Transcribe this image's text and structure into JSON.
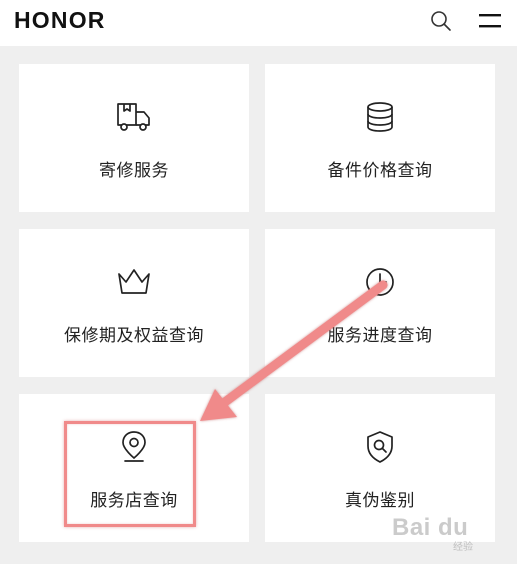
{
  "header": {
    "logo": "HONOR",
    "search_icon": "search-icon",
    "menu_icon": "hamburger-menu-icon"
  },
  "services": [
    {
      "label": "寄修服务",
      "icon": "delivery-truck-icon"
    },
    {
      "label": "备件价格查询",
      "icon": "database-stack-icon"
    },
    {
      "label": "保修期及权益查询",
      "icon": "crown-icon"
    },
    {
      "label": "服务进度查询",
      "icon": "clock-icon"
    },
    {
      "label": "服务店查询",
      "icon": "location-pin-icon"
    },
    {
      "label": "真伪鉴别",
      "icon": "shield-search-icon"
    }
  ],
  "annotation": {
    "highlight_color": "#f08a8a",
    "target": "服务店查询"
  },
  "watermark": {
    "brand": "Bai du",
    "sub": "经验"
  },
  "colors": {
    "background": "#efefef",
    "card": "#ffffff",
    "text": "#222222",
    "annotation": "#f08a8a"
  }
}
